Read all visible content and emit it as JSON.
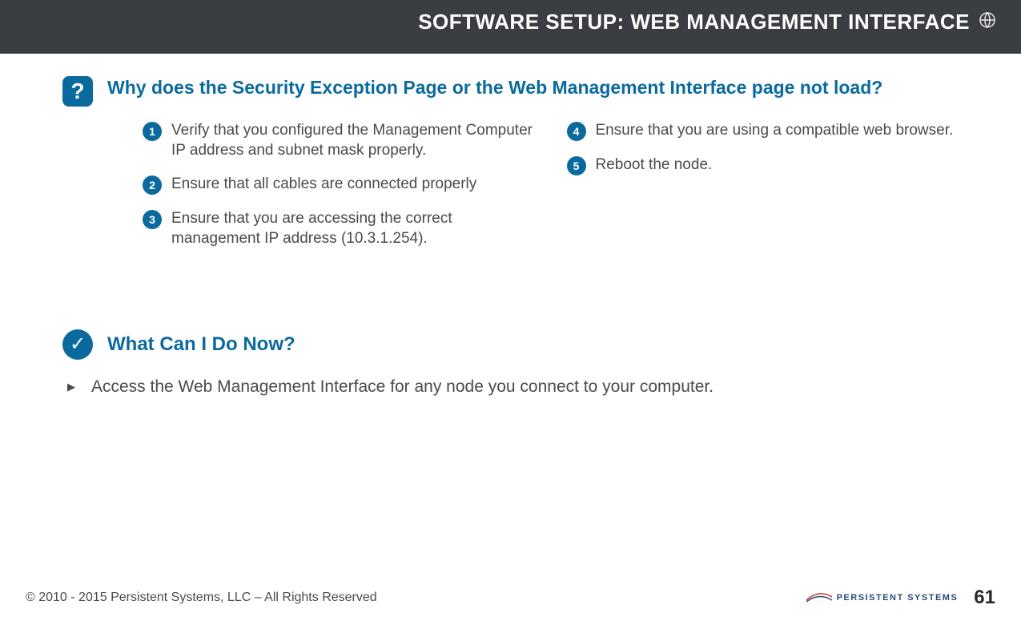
{
  "header": {
    "title": "SOFTWARE SETUP:  WEB MANAGEMENT INTERFACE"
  },
  "faq": {
    "question": "Why does the Security Exception Page or the Web Management Interface page not load?",
    "steps_left": [
      "Verify that you configured the Management Computer IP address and subnet mask properly.",
      "Ensure that all cables are connected properly",
      "Ensure that you are accessing the correct management IP address (10.3.1.254)."
    ],
    "steps_right": [
      "Ensure that you are using a compatible web browser.",
      "Reboot the node."
    ],
    "nums_left": [
      "1",
      "2",
      "3"
    ],
    "nums_right": [
      "4",
      "5"
    ]
  },
  "section2": {
    "title": "What Can I Do Now?",
    "bullets": [
      "Access the Web Management Interface for any node you connect to your computer."
    ]
  },
  "footer": {
    "copyright": "© 2010 - 2015 Persistent Systems, LLC – All Rights Reserved",
    "logo_text": "PERSISTENT SYSTEMS",
    "page": "61"
  }
}
